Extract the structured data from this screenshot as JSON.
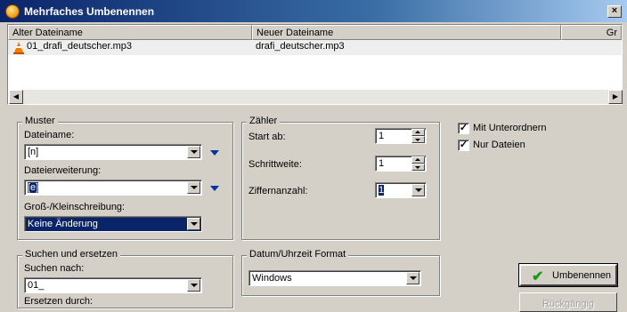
{
  "window": {
    "title": "Mehrfaches Umbenennen",
    "close_glyph": "×",
    "app_icon": "app-icon"
  },
  "list": {
    "columns": [
      "Alter Dateiname",
      "Neuer Dateiname",
      "Gr"
    ],
    "rows": [
      {
        "icon": "vlc-cone-icon",
        "old": "01_drafi_deutscher.mp3",
        "new": "drafi_deutscher.mp3"
      }
    ]
  },
  "muster": {
    "legend": "Muster",
    "dateiname_label": "Dateiname:",
    "dateiname_value": "[n]",
    "erweiterung_label": "Dateierweiterung:",
    "erweiterung_value": "[e]",
    "case_label": "Groß-/Kleinschreibung:",
    "case_value": "Keine Änderung"
  },
  "zaehler": {
    "legend": "Zähler",
    "start_label": "Start ab:",
    "start_value": "1",
    "step_label": "Schrittweite:",
    "step_value": "1",
    "digits_label": "Ziffernanzahl:",
    "digits_value": "1"
  },
  "options": {
    "subfolders": "Mit Unterordnern",
    "files_only": "Nur Dateien"
  },
  "suchen": {
    "legend": "Suchen und ersetzen",
    "search_label": "Suchen nach:",
    "search_value": "01_",
    "replace_label": "Ersetzen durch:"
  },
  "datum": {
    "legend": "Datum/Uhrzeit Format",
    "value": "Windows"
  },
  "buttons": {
    "rename": "Umbenennen",
    "undo": "Rückgängig"
  },
  "colors": {
    "titlebar": "#0a246a",
    "selection": "#0a246a",
    "check_green": "#1a9a1a"
  }
}
